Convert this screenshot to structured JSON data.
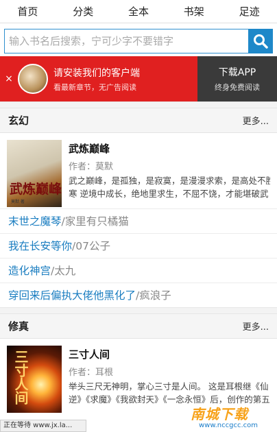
{
  "nav": {
    "items": [
      {
        "label": "首页"
      },
      {
        "label": "分类"
      },
      {
        "label": "全本"
      },
      {
        "label": "书架"
      },
      {
        "label": "足迹"
      }
    ]
  },
  "search": {
    "placeholder": "输入书名后搜索，宁可少字不要错字",
    "button_icon": "search-icon"
  },
  "banner": {
    "close": "×",
    "title": "请安装我们的客户端",
    "subtitle": "看最新章节，无广告阅读",
    "download_label": "下载APP",
    "download_sub": "终身免费阅读"
  },
  "sections": [
    {
      "title": "玄幻",
      "more": "更多...",
      "featured": {
        "name": "武炼巅峰",
        "author": "作者：莫默",
        "desc": "武之巅峰，是孤独，是寂寞，是漫漫求索，是高处不胜寒 逆境中成长，绝地里求生，不屈不饶，才能堪破武之极道。 凌霄阁试炼弟子兼扫地小厮",
        "cover_title": "武炼巅峰",
        "cover_sub": "莫默 著"
      },
      "list": [
        {
          "book": "末世之魔琴",
          "author": "/家里有只橘猫"
        },
        {
          "book": "我在长安等你",
          "author": "/07公子"
        },
        {
          "book": "造化神宫",
          "author": "/太九"
        },
        {
          "book": "穿回来后偏执大佬他黑化了",
          "author": "/疯浪子"
        }
      ]
    },
    {
      "title": "修真",
      "more": "更多...",
      "featured": {
        "name": "三寸人间",
        "author": "作者：耳根",
        "desc": "举头三尺无神明，掌心三寸是人间。 这是耳根继《仙逆》《求魔》《我欲封天》《一念永恒》后，创作的第五部长篇小说",
        "cover_title": "三寸人间"
      }
    }
  ],
  "status_bar": "正在等待 www.jx.la...",
  "watermark": {
    "text": "南城下载",
    "url": "www.nccgcc.com"
  },
  "colors": {
    "accent": "#1e88c9",
    "banner_red": "#e02020",
    "link": "#1a7dc0"
  }
}
